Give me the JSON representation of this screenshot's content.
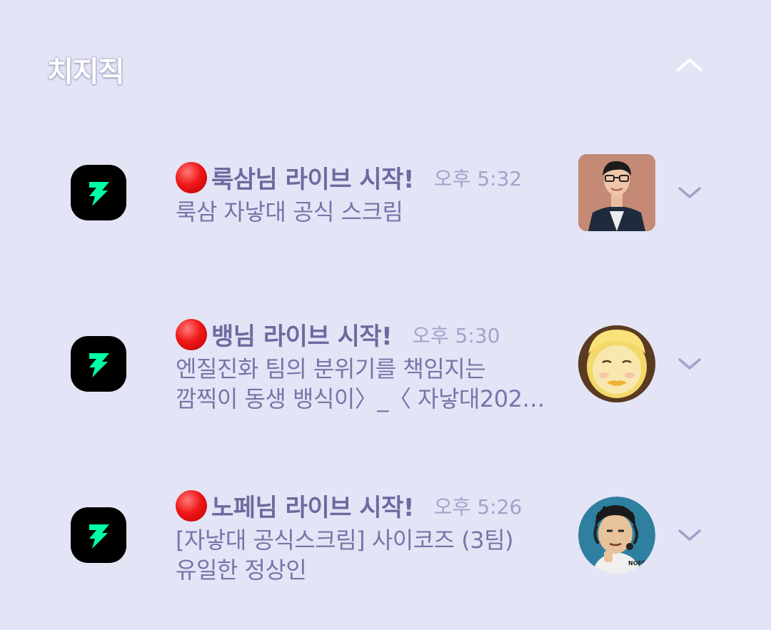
{
  "app": {
    "name": "치지직"
  },
  "colors": {
    "background": "#e4e4f7",
    "title": "#6c6a9e",
    "body": "#7775a8",
    "time": "#a3a1c9",
    "brand_green": "#00ffa3",
    "live_red": "#f01818"
  },
  "icons": {
    "collapse": "chevron-up-icon",
    "expand": "chevron-down-icon",
    "app": "chzzk-logo-icon",
    "live": "red-circle-icon"
  },
  "notifications": [
    {
      "title": "룩삼님 라이브 시작!",
      "time": "오후 5:32",
      "body_lines": [
        "룩삼 자낳대 공식 스크림"
      ]
    },
    {
      "title": "뱅님 라이브 시작!",
      "time": "오후 5:30",
      "body_lines": [
        "엔질진화 팀의 분위기를 책임지는",
        "깜찍이 동생 뱅식이〉_〈 자낳대202…"
      ]
    },
    {
      "title": "노페님 라이브 시작!",
      "time": "오후 5:26",
      "body_lines": [
        "[자낳대 공식스크림] 사이코즈 (3팀)",
        "유일한 정상인"
      ]
    }
  ]
}
